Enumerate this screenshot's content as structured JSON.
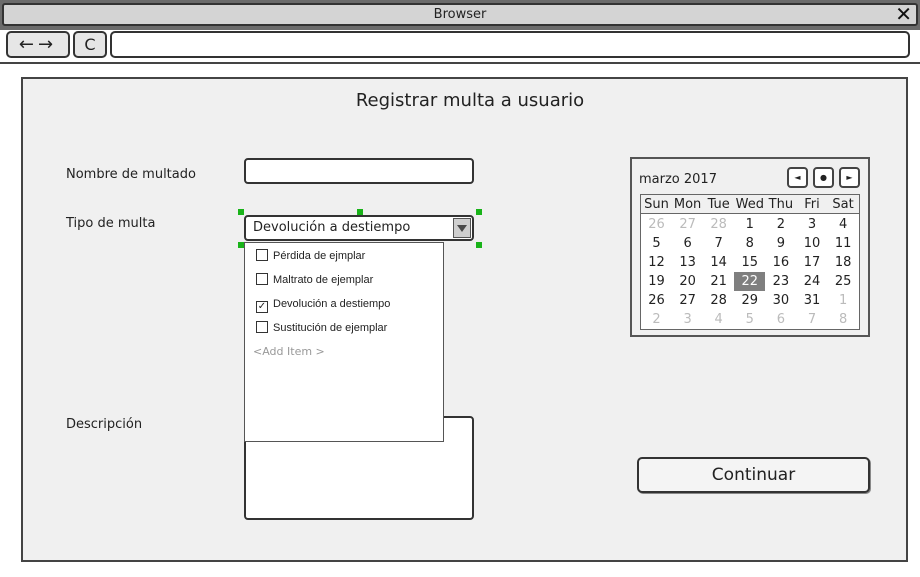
{
  "window": {
    "title": "Browser",
    "close_glyph": "✕",
    "back_forward_glyphs": "←→",
    "reload_glyph": "C",
    "url": ""
  },
  "form": {
    "title": "Registrar multa a usuario",
    "nombre_label": "Nombre de multado",
    "nombre_value": "",
    "tipo_label": "Tipo de multa",
    "tipo_selected": "Devolución a destiempo",
    "descripcion_label": "Descripción",
    "descripcion_value": "",
    "continuar_label": "Continuar"
  },
  "dropdown": {
    "items": [
      {
        "label": "Pérdida de ejmplar",
        "checked": false
      },
      {
        "label": "Maltrato de ejemplar",
        "checked": false
      },
      {
        "label": "Devolución a destiempo",
        "checked": true
      },
      {
        "label": "Sustitución de ejemplar",
        "checked": false
      }
    ],
    "add_item": "<Add Item >",
    "check_glyph": "✓"
  },
  "calendar": {
    "month_label": "marzo 2017",
    "prev_glyph": "◄",
    "today_glyph": "●",
    "next_glyph": "►",
    "weekdays": [
      "Sun",
      "Mon",
      "Tue",
      "Wed",
      "Thu",
      "Fri",
      "Sat"
    ],
    "selected_day": "22",
    "weeks": [
      [
        "26",
        "27",
        "28",
        "1",
        "2",
        "3",
        "4"
      ],
      [
        "5",
        "6",
        "7",
        "8",
        "9",
        "10",
        "11"
      ],
      [
        "12",
        "13",
        "14",
        "15",
        "16",
        "17",
        "18"
      ],
      [
        "19",
        "20",
        "21",
        "22",
        "23",
        "24",
        "25"
      ],
      [
        "26",
        "27",
        "28",
        "29",
        "30",
        "31",
        "1"
      ],
      [
        "2",
        "3",
        "4",
        "5",
        "6",
        "7",
        "8"
      ]
    ],
    "muted": [
      [
        true,
        true,
        true,
        false,
        false,
        false,
        false
      ],
      [
        false,
        false,
        false,
        false,
        false,
        false,
        false
      ],
      [
        false,
        false,
        false,
        false,
        false,
        false,
        false
      ],
      [
        false,
        false,
        false,
        false,
        false,
        false,
        false
      ],
      [
        false,
        false,
        false,
        false,
        false,
        false,
        true
      ],
      [
        true,
        true,
        true,
        true,
        true,
        true,
        true
      ]
    ]
  },
  "colors": {
    "selection_handles": "#19b319",
    "selected_day_bg": "#7f7f7f"
  }
}
